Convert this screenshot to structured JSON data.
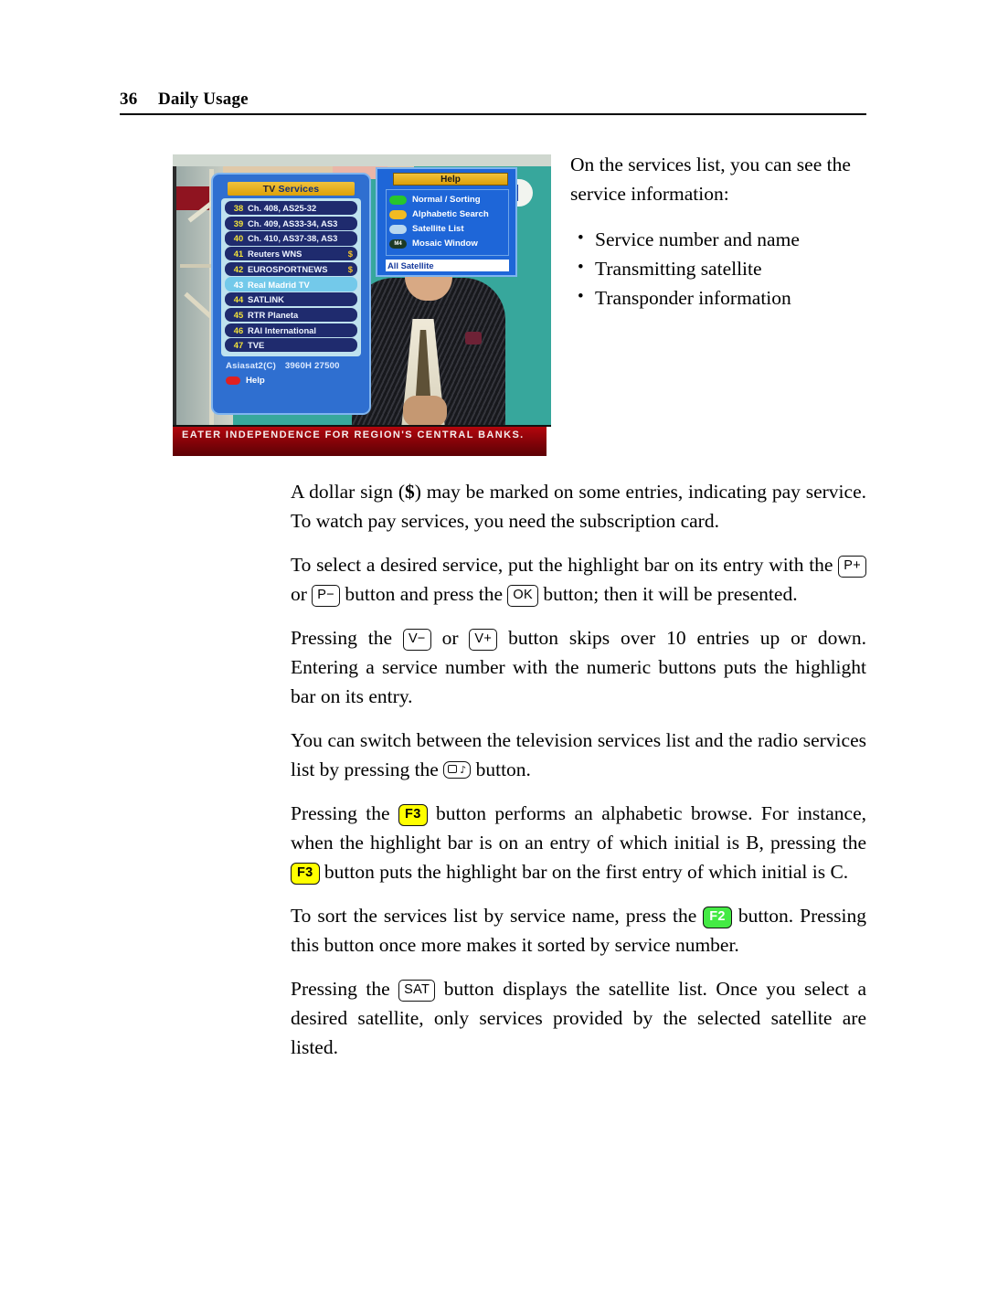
{
  "page": {
    "number": "36",
    "title": "Daily Usage"
  },
  "figure": {
    "caption_alt": "tv-services-list-osd-screenshot",
    "osd": {
      "list_panel": {
        "title_prefix": "TV",
        "title_suffix": "Services",
        "title_full": "TV Services",
        "rows": [
          {
            "number": "38",
            "name": "Ch. 408, AS25-32",
            "pay": ""
          },
          {
            "number": "39",
            "name": "Ch. 409,  AS33-34, AS3",
            "pay": ""
          },
          {
            "number": "40",
            "name": "Ch. 410, AS37-38, AS3",
            "pay": ""
          },
          {
            "number": "41",
            "name": "Reuters WNS",
            "pay": "$"
          },
          {
            "number": "42",
            "name": "EUROSPORTNEWS",
            "pay": "$"
          },
          {
            "number": "43",
            "name": "Real Madrid TV",
            "pay": ""
          },
          {
            "number": "44",
            "name": "SATLINK",
            "pay": ""
          },
          {
            "number": "45",
            "name": "RTR Planeta",
            "pay": ""
          },
          {
            "number": "46",
            "name": "RAI International",
            "pay": ""
          },
          {
            "number": "47",
            "name": "TVE",
            "pay": ""
          }
        ],
        "selected_index": 5,
        "footer_satellite": "Asiasat2(C)",
        "footer_transponder": "3960H  27500",
        "help_label": "Help",
        "help_key_color": "#e02020"
      },
      "help_panel": {
        "title": "Help",
        "items": [
          {
            "label": "Normal  / Sorting",
            "key_color": "#27c62c",
            "key_text": ""
          },
          {
            "label": "Alphabetic Search",
            "key_color": "#f2bb22",
            "key_text": ""
          },
          {
            "label": "Satellite List",
            "key_color": "#b9d8ef",
            "key_text": ""
          },
          {
            "label": "Mosaic Window",
            "key_color": "#1d3a24",
            "key_text": "M4"
          }
        ],
        "satellite_filter": "All Satellite"
      },
      "ticker": "EATER INDEPENDENCE FOR REGION'S CENTRAL BANKS."
    }
  },
  "intro": {
    "lead": "On the services list, you can see the service information:",
    "bullets": [
      "Service number and name",
      "Transmitting satellite",
      "Transponder information"
    ]
  },
  "body": {
    "p1_a": "A dollar sign (",
    "p1_dollar": "$",
    "p1_b": ") may be marked on some entries, indicating pay service. To watch pay services, you need the subscription card.",
    "p2_a": "To select a desired service, put the highlight bar on its entry with the",
    "p2_key1": "P+",
    "p2_b": "or",
    "p2_key2": "P−",
    "p2_c": "button and press the",
    "p2_key3": "OK",
    "p2_d": "button; then it will be presented.",
    "p3_a": "Pressing the",
    "p3_key1": "V−",
    "p3_b": "or",
    "p3_key2": "V+",
    "p3_c": "button skips over 10 entries up or down. Entering a service number with the numeric buttons puts the highlight bar on its entry.",
    "p4_a": "You can switch between the television services list and the radio services list by pressing the",
    "p4_b": "button.",
    "p5_a": "Pressing the",
    "p5_key1": "F3",
    "p5_b": "button performs an alphabetic browse.  For instance, when the highlight bar is on an entry of which initial is B, pressing the",
    "p5_key2": "F3",
    "p5_c": "button puts the highlight bar on the first entry of which initial is C.",
    "p6_a": "To sort the services list by service name, press the",
    "p6_key1": "F2",
    "p6_b": "button. Pressing this button once more makes it sorted by service number.",
    "p7_a": "Pressing the",
    "p7_key1": "SAT",
    "p7_b": "button displays the satellite list.   Once you select a desired satellite, only services provided by the selected satellite are listed."
  }
}
